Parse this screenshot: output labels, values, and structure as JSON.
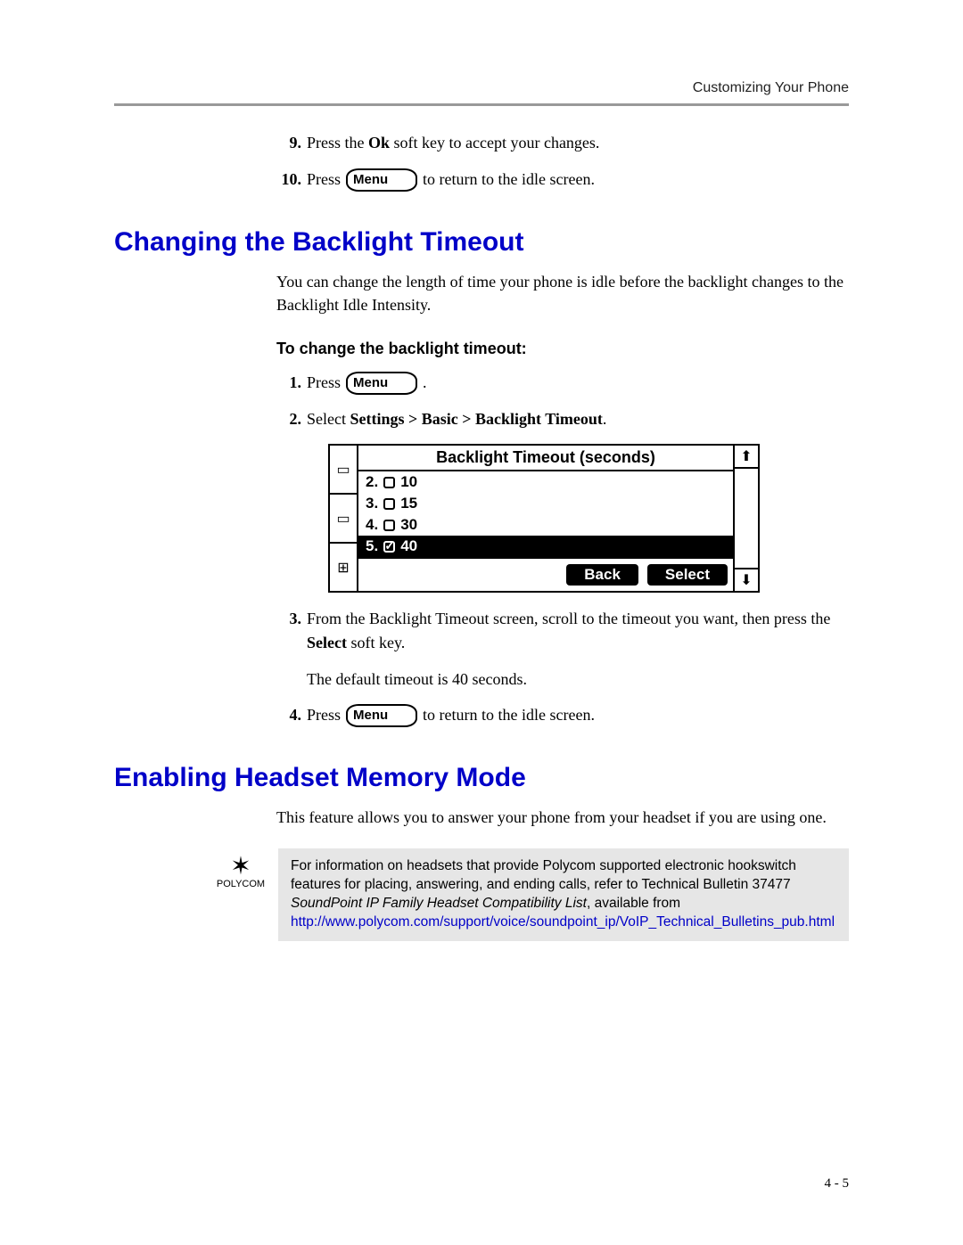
{
  "header": {
    "section": "Customizing Your Phone"
  },
  "menu_key_label": "Menu",
  "steps_top": {
    "s9": {
      "num": "9.",
      "pre": "Press the ",
      "bold": "Ok",
      "post": " soft key to accept your changes."
    },
    "s10": {
      "num": "10.",
      "pre": "Press ",
      "post": " to return to the idle screen."
    }
  },
  "h_backlight": "Changing the Backlight Timeout",
  "p_backlight": "You can change the length of time your phone is idle before the backlight changes to the Backlight Idle Intensity.",
  "proc_backlight": "To change the backlight timeout:",
  "bsteps": {
    "s1": {
      "num": "1.",
      "pre": "Press ",
      "post": " ."
    },
    "s2": {
      "num": "2.",
      "pre": "Select ",
      "bold": "Settings > Basic > Backlight Timeout",
      "post": "."
    },
    "s3": {
      "num": "3.",
      "pre": "From the Backlight Timeout screen, scroll to the timeout you want, then press the ",
      "bold": "Select",
      "post": " soft key."
    },
    "s3b": "The default timeout is 40 seconds.",
    "s4": {
      "num": "4.",
      "pre": "Press ",
      "post": " to return to the idle screen."
    }
  },
  "phone": {
    "title": "Backlight Timeout (seconds)",
    "rows": [
      {
        "n": "2.",
        "val": "10",
        "checked": false,
        "sel": false
      },
      {
        "n": "3.",
        "val": "15",
        "checked": false,
        "sel": false
      },
      {
        "n": "4.",
        "val": "30",
        "checked": false,
        "sel": false
      },
      {
        "n": "5.",
        "val": "40",
        "checked": true,
        "sel": true
      }
    ],
    "back": "Back",
    "select": "Select"
  },
  "h_headset": "Enabling Headset Memory Mode",
  "p_headset": "This feature allows you to answer your phone from your headset if you are using one.",
  "note": {
    "logo_text": "POLYCOM",
    "line1": "For information on headsets that provide Polycom supported electronic hookswitch features for placing, answering, and ending calls, refer to Technical Bulletin 37477 ",
    "italic": "SoundPoint IP Family Headset Compatibility List",
    "line1b": ", available from",
    "url": "http://www.polycom.com/support/voice/soundpoint_ip/VoIP_Technical_Bulletins_pub.html"
  },
  "footer": "4 - 5"
}
